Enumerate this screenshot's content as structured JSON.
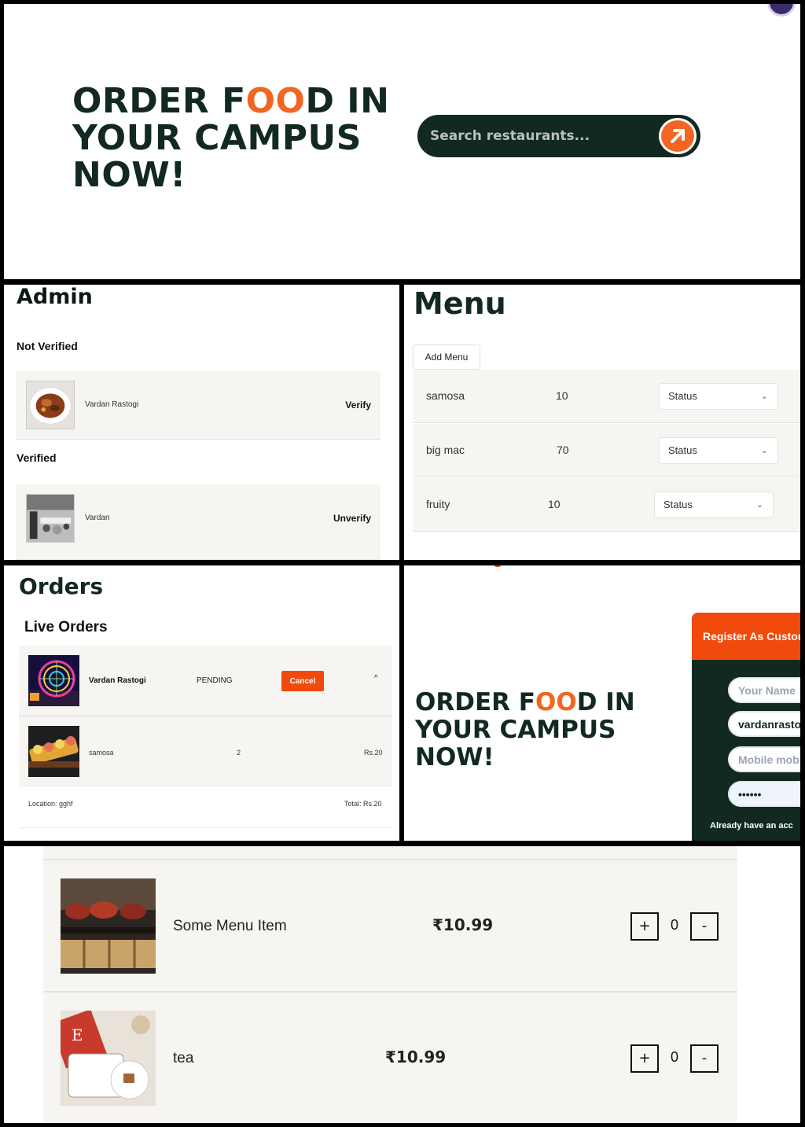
{
  "hero": {
    "title_part1": "ORDER F",
    "title_accent": "OO",
    "title_part2": "D IN",
    "title_line2": "YOUR CAMPUS",
    "title_line3": "NOW!",
    "search_placeholder": "Search restaurants...",
    "search_icon": "arrow-up-right-icon"
  },
  "admin": {
    "heading": "Admin",
    "not_verified_label": "Not Verified",
    "verified_label": "Verified",
    "not_verified_items": [
      {
        "name": "Vardan Rastogi",
        "action": "Verify"
      }
    ],
    "verified_items": [
      {
        "name": "Vardan",
        "action": "Unverify"
      }
    ]
  },
  "menu": {
    "heading": "Menu",
    "add_button": "Add Menu",
    "items": [
      {
        "name": "samosa",
        "price": "10",
        "status": "Status"
      },
      {
        "name": "big mac",
        "price": "70",
        "status": "Status"
      },
      {
        "name": "fruity",
        "price": "10",
        "status": "Status"
      }
    ]
  },
  "orders": {
    "heading": "Orders",
    "live_heading": "Live Orders",
    "order": {
      "customer": "Vardan Rastogi",
      "status": "PENDING",
      "cancel_label": "Cancel",
      "caret": "^",
      "item_name": "samosa",
      "item_qty": "2",
      "item_price": "Rs.20",
      "location": "Location: gghf",
      "total": "Total: Rs.20"
    }
  },
  "register": {
    "title_part1": "ORDER F",
    "title_accent": "OO",
    "title_part2": "D IN",
    "title_line2": "YOUR CAMPUS",
    "title_line3": "NOW!",
    "card_title": "Register As Custom",
    "name_placeholder": "Your Name",
    "email_value": "vardanrasto",
    "mobile_placeholder": "Mobile mob",
    "password_value": "••••••",
    "already_text": "Already have an acc"
  },
  "items": [
    {
      "name": "Some Menu Item",
      "price": "₹10.99",
      "plus": "+",
      "qty": "0",
      "minus": "-"
    },
    {
      "name": "tea",
      "price": "₹10.99",
      "plus": "+",
      "qty": "0",
      "minus": "-"
    }
  ],
  "colors": {
    "brand_dark": "#12291f",
    "accent_orange": "#f26522",
    "cancel_red": "#f04a0d",
    "card_bg": "#f6f5f1"
  }
}
